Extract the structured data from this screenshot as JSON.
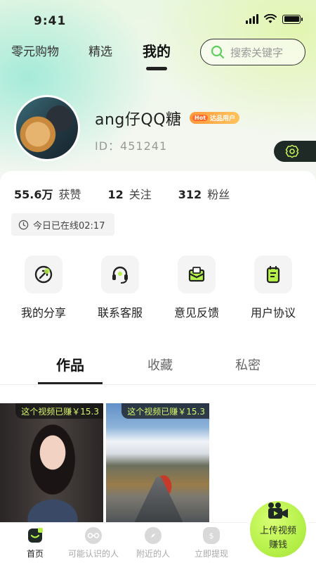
{
  "status_bar": {
    "time": "9:41"
  },
  "top_tabs": [
    {
      "label": "零元购物"
    },
    {
      "label": "精选"
    },
    {
      "label": "我的"
    }
  ],
  "search": {
    "placeholder": "搜索关键字"
  },
  "profile": {
    "username": "ang仔QQ糖",
    "badge_hot": "Hot",
    "badge_text": "达品用户",
    "id_label": "ID：451241"
  },
  "stats": [
    {
      "value": "55.6万",
      "label": "获赞"
    },
    {
      "value": "12",
      "label": "关注"
    },
    {
      "value": "312",
      "label": "粉丝"
    }
  ],
  "online_status": "今日已在线02:17",
  "actions": [
    {
      "label": "我的分享",
      "icon": "share-icon"
    },
    {
      "label": "联系客服",
      "icon": "headset-icon"
    },
    {
      "label": "意见反馈",
      "icon": "mail-icon"
    },
    {
      "label": "用户协议",
      "icon": "document-icon"
    }
  ],
  "content_tabs": [
    {
      "label": "作品"
    },
    {
      "label": "收藏"
    },
    {
      "label": "私密"
    }
  ],
  "videos": [
    {
      "earn_text": "这个视频已赚￥15.3"
    },
    {
      "earn_text": "这个视频已赚￥15.3"
    }
  ],
  "bottom_nav": [
    {
      "label": "首页",
      "icon": "home-icon"
    },
    {
      "label": "可能认识的人",
      "icon": "glasses-icon"
    },
    {
      "label": "附近的人",
      "icon": "compass-icon"
    },
    {
      "label": "立即提现",
      "icon": "money-bag-icon"
    }
  ],
  "upload_button": {
    "line1": "上传视频",
    "line2": "赚钱"
  },
  "colors": {
    "accent": "#b6f04a",
    "dark": "#1f2a27"
  }
}
